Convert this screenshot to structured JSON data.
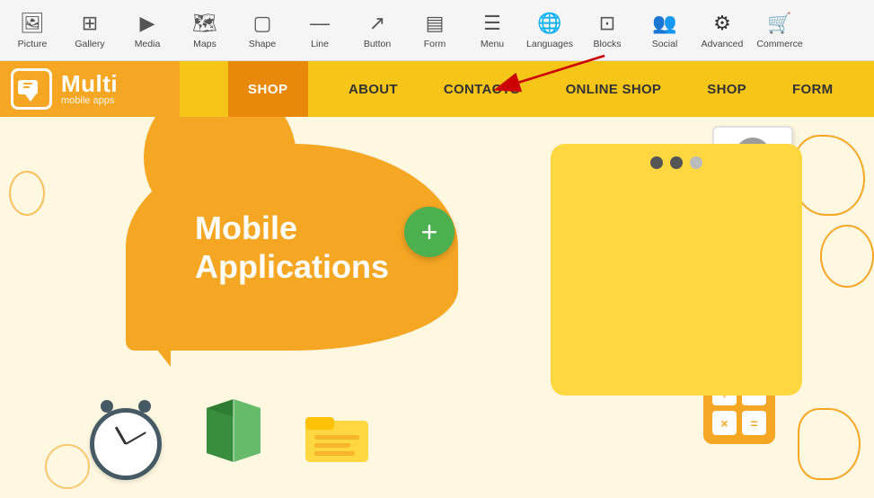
{
  "toolbar": {
    "items": [
      {
        "id": "picture",
        "label": "Picture",
        "icon": "🖼"
      },
      {
        "id": "gallery",
        "label": "Gallery",
        "icon": "⊞"
      },
      {
        "id": "media",
        "label": "Media",
        "icon": "▶"
      },
      {
        "id": "maps",
        "label": "Maps",
        "icon": "🗺"
      },
      {
        "id": "shape",
        "label": "Shape",
        "icon": "▢"
      },
      {
        "id": "line",
        "label": "Line",
        "icon": "—"
      },
      {
        "id": "button",
        "label": "Button",
        "icon": "↗"
      },
      {
        "id": "form",
        "label": "Form",
        "icon": "▤"
      },
      {
        "id": "menu",
        "label": "Menu",
        "icon": "🍔"
      },
      {
        "id": "languages",
        "label": "Languages",
        "icon": "🌐"
      },
      {
        "id": "blocks",
        "label": "Blocks",
        "icon": "⊡"
      },
      {
        "id": "social",
        "label": "Social",
        "icon": "👥"
      },
      {
        "id": "advanced",
        "label": "Advanced",
        "icon": "⚙"
      },
      {
        "id": "commerce",
        "label": "Commerce",
        "icon": "🛒"
      }
    ]
  },
  "navbar": {
    "brand_name": "Multi",
    "brand_sub": "mobile apps",
    "shop_active": "SHOP",
    "nav_links": [
      "ABOUT",
      "CONTACTS",
      "ONLINE SHOP",
      "SHOP",
      "FORM"
    ]
  },
  "hero": {
    "title_line1": "Mobile",
    "title_line2": "Applications"
  },
  "plus_button": "+",
  "calc_symbols": [
    "+",
    "−",
    "×",
    "="
  ]
}
